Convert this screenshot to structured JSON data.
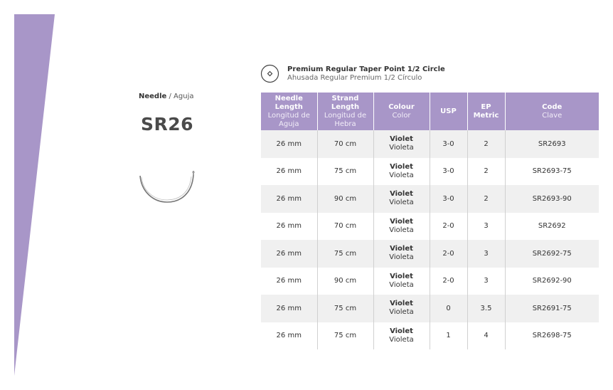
{
  "colors": {
    "accent": "#a896c8",
    "row_alt": "#f0f0f0"
  },
  "needle": {
    "label_en": "Needle",
    "label_sep": " / ",
    "label_es": "Aguja",
    "code": "SR26",
    "icon": "half-circle-needle-icon"
  },
  "product": {
    "icon": "taper-point-icon",
    "title_en": "Premium Regular Taper Point 1/2 Circle",
    "title_es": "Ahusada Regular Premium 1/2 Círculo"
  },
  "table": {
    "headers": [
      {
        "en": "Needle Length",
        "es": "Longitud de Aguja"
      },
      {
        "en": "Strand Length",
        "es": "Longitud de Hebra"
      },
      {
        "en": "Colour",
        "es": "Color"
      },
      {
        "en": "USP",
        "es": ""
      },
      {
        "en": "EP Metric",
        "es": ""
      },
      {
        "en": "Code",
        "es": "Clave"
      }
    ],
    "rows": [
      {
        "needle_length": "26 mm",
        "strand_length": "70 cm",
        "colour_en": "Violet",
        "colour_es": "Violeta",
        "usp": "3-0",
        "ep": "2",
        "code": "SR2693"
      },
      {
        "needle_length": "26 mm",
        "strand_length": "75 cm",
        "colour_en": "Violet",
        "colour_es": "Violeta",
        "usp": "3-0",
        "ep": "2",
        "code": "SR2693-75"
      },
      {
        "needle_length": "26 mm",
        "strand_length": "90 cm",
        "colour_en": "Violet",
        "colour_es": "Violeta",
        "usp": "3-0",
        "ep": "2",
        "code": "SR2693-90"
      },
      {
        "needle_length": "26 mm",
        "strand_length": "70 cm",
        "colour_en": "Violet",
        "colour_es": "Violeta",
        "usp": "2-0",
        "ep": "3",
        "code": "SR2692"
      },
      {
        "needle_length": "26 mm",
        "strand_length": "75 cm",
        "colour_en": "Violet",
        "colour_es": "Violeta",
        "usp": "2-0",
        "ep": "3",
        "code": "SR2692-75"
      },
      {
        "needle_length": "26 mm",
        "strand_length": "90 cm",
        "colour_en": "Violet",
        "colour_es": "Violeta",
        "usp": "2-0",
        "ep": "3",
        "code": "SR2692-90"
      },
      {
        "needle_length": "26 mm",
        "strand_length": "75 cm",
        "colour_en": "Violet",
        "colour_es": "Violeta",
        "usp": "0",
        "ep": "3.5",
        "code": "SR2691-75"
      },
      {
        "needle_length": "26 mm",
        "strand_length": "75 cm",
        "colour_en": "Violet",
        "colour_es": "Violeta",
        "usp": "1",
        "ep": "4",
        "code": "SR2698-75"
      }
    ]
  }
}
